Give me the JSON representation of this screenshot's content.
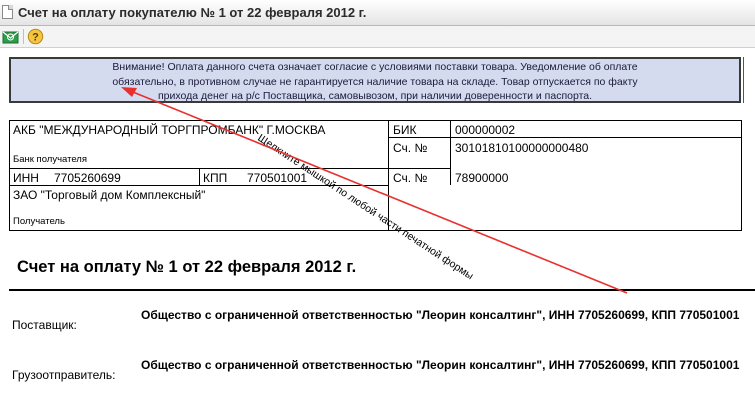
{
  "window": {
    "title": "Счет на оплату покупателю № 1 от 22 февраля 2012 г."
  },
  "notice": {
    "text": "Внимание! Оплата данного счета означает согласие с условиями поставки товара. Уведомление об оплате\nобязательно, в противном случае не гарантируется наличие товара на складе. Товар отпускается по факту\nприхода денег на р/с Поставщика, самовывозом, при наличии доверенности и паспорта."
  },
  "bank_details": {
    "bank_name": "АКБ \"МЕЖДУНАРОДНЫЙ ТОРГПРОМБАНК\" Г.МОСКВА",
    "bank_label": "Банк получателя",
    "bik_label": "БИК",
    "bik_value": "000000002",
    "corr_account_label": "Сч. №",
    "corr_account_value": "30101810100000000480",
    "inn_label": "ИНН",
    "inn_value": "7705260699",
    "kpp_label": "КПП",
    "kpp_value": "770501001",
    "account_label": "Сч. №",
    "account_value": "78900000",
    "recipient_name": "ЗАО \"Торговый дом Комплексный\"",
    "recipient_label": "Получатель"
  },
  "invoice": {
    "heading": "Счет на оплату № 1 от 22 февраля 2012 г."
  },
  "parties": {
    "supplier_label": "Поставщик:",
    "supplier_value": "Общество с ограниченной ответственностью \"Леорин консалтинг\", ИНН 7705260699, КПП 770501001",
    "shipper_label": "Грузоотправитель:",
    "shipper_value": "Общество с ограниченной ответственностью \"Леорин консалтинг\", ИНН 7705260699, КПП 770501001"
  },
  "annotation": {
    "text": "Щелкните мышкой по любой части печатной формы",
    "color": "#e8312f"
  },
  "toolbar": {
    "icons": [
      "email-icon",
      "help-icon"
    ]
  }
}
